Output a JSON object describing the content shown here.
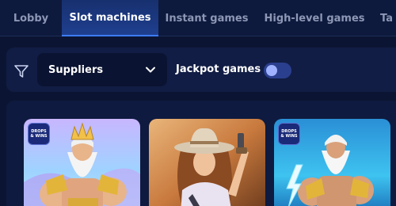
{
  "tabs": [
    {
      "label": "Lobby",
      "active": false
    },
    {
      "label": "Slot machines",
      "active": true
    },
    {
      "label": "Instant games",
      "active": false
    },
    {
      "label": "High-level games",
      "active": false
    },
    {
      "label": "Ta",
      "active": false
    }
  ],
  "filters": {
    "icon": "filter-icon",
    "suppliers_label": "Suppliers",
    "jackpot_label": "Jackpot games",
    "jackpot_on": false
  },
  "games": [
    {
      "name": "zeus-game",
      "badge": {
        "line1": "DROPS",
        "line2": "& WINS"
      }
    },
    {
      "name": "cowgirl-game",
      "badge": null
    },
    {
      "name": "zeus-lightning-game",
      "badge": {
        "line1": "DROPS",
        "line2": "& WINS"
      }
    }
  ],
  "colors": {
    "background": "#0b1533",
    "active_tab": "#1f3f8f",
    "accent": "#3d7bff"
  }
}
